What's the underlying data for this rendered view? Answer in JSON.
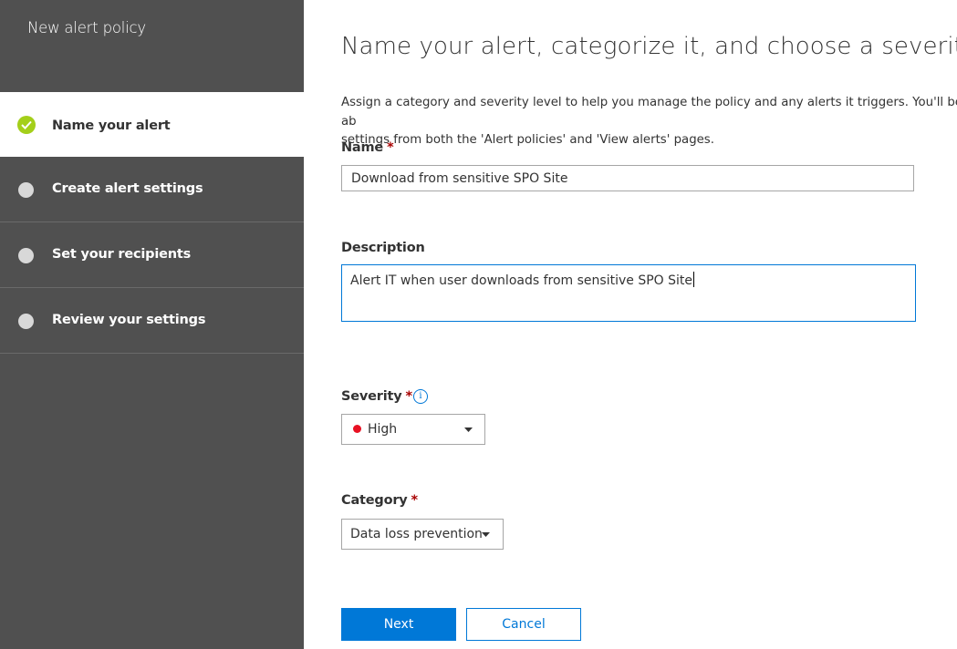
{
  "sidebar": {
    "title": "New alert policy",
    "steps": [
      {
        "label": "Name your alert",
        "state": "completed"
      },
      {
        "label": "Create alert settings",
        "state": "pending"
      },
      {
        "label": "Set your recipients",
        "state": "pending"
      },
      {
        "label": "Review your settings",
        "state": "pending"
      }
    ]
  },
  "main": {
    "title": "Name your alert, categorize it, and choose a severity.",
    "intro": "Assign a category and severity level to help you manage the policy and any alerts it triggers. You'll be ab\nsettings from both the 'Alert policies' and 'View alerts' pages.",
    "required_marker": "*",
    "name": {
      "label": "Name",
      "value": "Download from sensitive SPO Site"
    },
    "description": {
      "label": "Description",
      "value": "Alert IT when user downloads from sensitive SPO Site"
    },
    "severity": {
      "label": "Severity",
      "value": "High",
      "info_icon": "i"
    },
    "category": {
      "label": "Category",
      "value": "Data loss prevention"
    },
    "buttons": {
      "next": "Next",
      "cancel": "Cancel"
    }
  },
  "colors": {
    "sidebar_bg": "#505050",
    "accent": "#0078d7",
    "completed": "#a4cf1a",
    "required": "#a80000",
    "severity_high": "#e81123"
  }
}
